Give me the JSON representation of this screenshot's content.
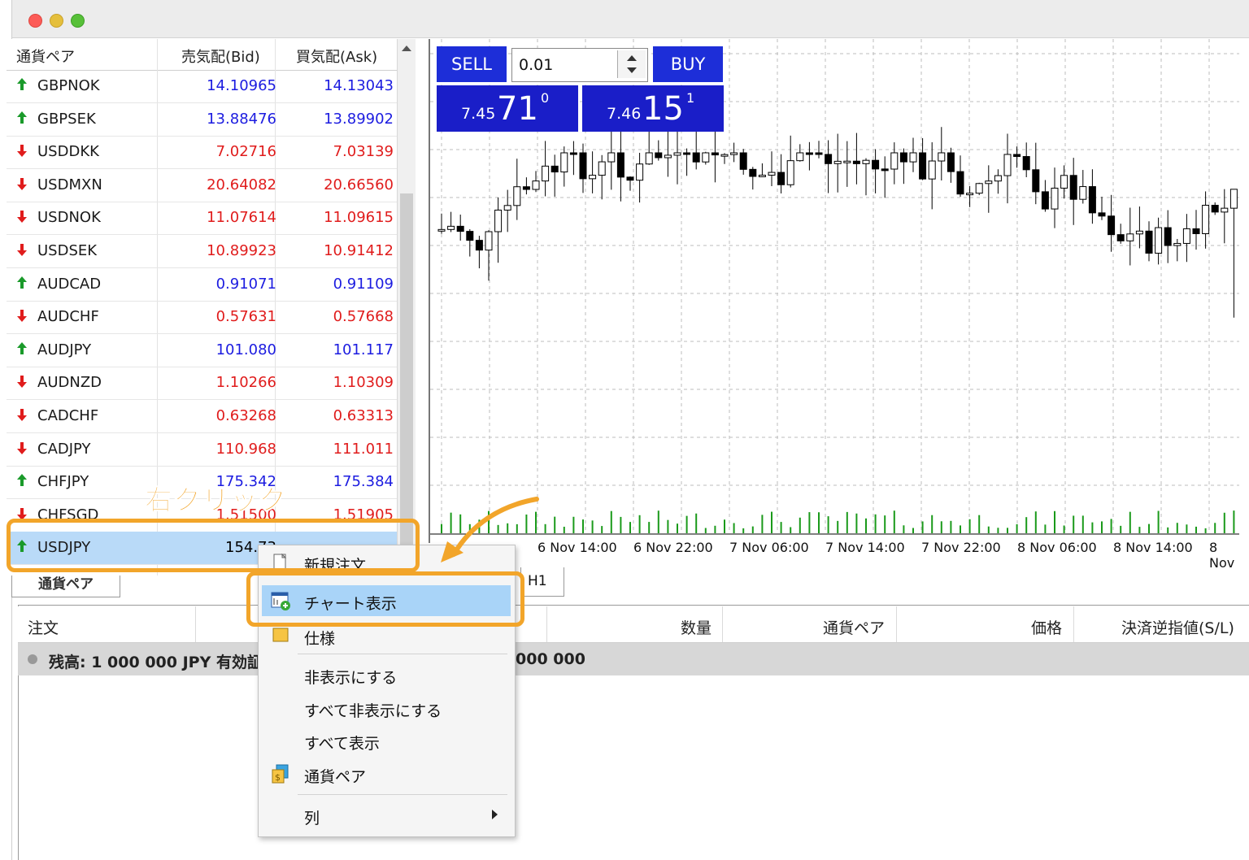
{
  "market_watch": {
    "headers": {
      "symbol": "通貨ペア",
      "bid": "売気配(Bid)",
      "ask": "買気配(Ask)"
    },
    "rows": [
      {
        "symbol": "GBPNOK",
        "bid": "14.10965",
        "ask": "14.13043",
        "dir": "up"
      },
      {
        "symbol": "GBPSEK",
        "bid": "13.88476",
        "ask": "13.89902",
        "dir": "up"
      },
      {
        "symbol": "USDDKK",
        "bid": "7.02716",
        "ask": "7.03139",
        "dir": "down"
      },
      {
        "symbol": "USDMXN",
        "bid": "20.64082",
        "ask": "20.66560",
        "dir": "down"
      },
      {
        "symbol": "USDNOK",
        "bid": "11.07614",
        "ask": "11.09615",
        "dir": "down"
      },
      {
        "symbol": "USDSEK",
        "bid": "10.89923",
        "ask": "10.91412",
        "dir": "down"
      },
      {
        "symbol": "AUDCAD",
        "bid": "0.91071",
        "ask": "0.91109",
        "dir": "up"
      },
      {
        "symbol": "AUDCHF",
        "bid": "0.57631",
        "ask": "0.57668",
        "dir": "down"
      },
      {
        "symbol": "AUDJPY",
        "bid": "101.080",
        "ask": "101.117",
        "dir": "up"
      },
      {
        "symbol": "AUDNZD",
        "bid": "1.10266",
        "ask": "1.10309",
        "dir": "down"
      },
      {
        "symbol": "CADCHF",
        "bid": "0.63268",
        "ask": "0.63313",
        "dir": "down"
      },
      {
        "symbol": "CADJPY",
        "bid": "110.968",
        "ask": "111.011",
        "dir": "down"
      },
      {
        "symbol": "CHFJPY",
        "bid": "175.342",
        "ask": "175.384",
        "dir": "up"
      },
      {
        "symbol": "CHFSGD",
        "bid": "1.51500",
        "ask": "1.51905",
        "dir": "down"
      },
      {
        "symbol": "USDJPY",
        "bid": "154.73",
        "ask": "",
        "dir": "up"
      }
    ],
    "tab_label": "通貨ペア"
  },
  "trade_panel": {
    "sell_label": "SELL",
    "buy_label": "BUY",
    "lot_value": "0.01",
    "sell_small": "7.45",
    "sell_big": "71",
    "sell_sup": "0",
    "buy_small": "7.46",
    "buy_big": "15",
    "buy_sup": "1"
  },
  "chart": {
    "x_labels": [
      "6 Nov 14:00",
      "6 Nov 22:00",
      "7 Nov 06:00",
      "7 Nov 14:00",
      "7 Nov 22:00",
      "8 Nov 06:00",
      "8 Nov 14:00",
      "8 Nov"
    ],
    "timeframe_tab": "H1",
    "colors": {
      "volume": "#1a9a1a",
      "grid": "#bdbdbd",
      "candle": "#000000"
    }
  },
  "terminal": {
    "headers": [
      "注文",
      "数量",
      "通貨ペア",
      "価格",
      "決済逆指値(S/L)"
    ],
    "balance_left": "残高: 1 000 000 JPY  有効証",
    "balance_right": "000 000"
  },
  "context_menu": {
    "items": [
      {
        "label": "新規注文",
        "icon": "new-order-icon"
      },
      {
        "label": "チャート表示",
        "icon": "chart-window-icon",
        "highlighted": true
      },
      {
        "label": "仕様",
        "icon": "specification-icon"
      },
      {
        "label": "非表示にする",
        "icon": ""
      },
      {
        "label": "すべて非表示にする",
        "icon": ""
      },
      {
        "label": "すべて表示",
        "icon": ""
      },
      {
        "label": "通貨ペア",
        "icon": "currency-pairs-icon"
      },
      {
        "label": "列",
        "icon": "",
        "submenu": true
      }
    ]
  },
  "annotation": {
    "callout": "右クリック",
    "color": "#f2a52a"
  }
}
